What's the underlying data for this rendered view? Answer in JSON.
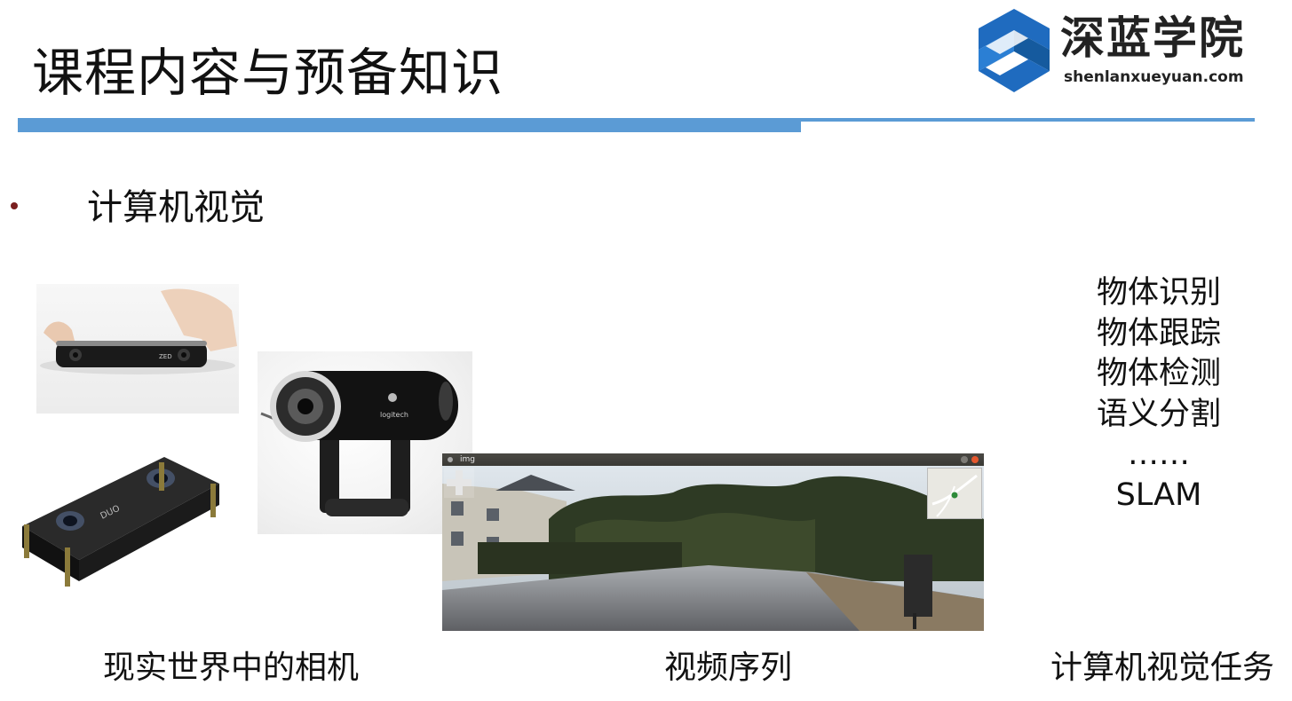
{
  "slide": {
    "title": "课程内容与预备知识",
    "bullet": "计算机视觉"
  },
  "logo": {
    "name_cn": "深蓝学院",
    "name_en": "shenlanxueyuan.com",
    "brand_color": "#1f6bbf"
  },
  "colors": {
    "divider": "#5b9bd5",
    "bullet_dot": "#7a1f1f"
  },
  "tasks": [
    "物体识别",
    "物体跟踪",
    "物体检测",
    "语义分割",
    "……",
    "SLAM"
  ],
  "images": {
    "zed_camera_label": "ZED",
    "webcam_label": "logitech",
    "ducati_label": "DUO"
  },
  "video_window": {
    "title": "img"
  },
  "captions": {
    "cameras": "现实世界中的相机",
    "video": "视频序列",
    "tasks": "计算机视觉任务"
  }
}
